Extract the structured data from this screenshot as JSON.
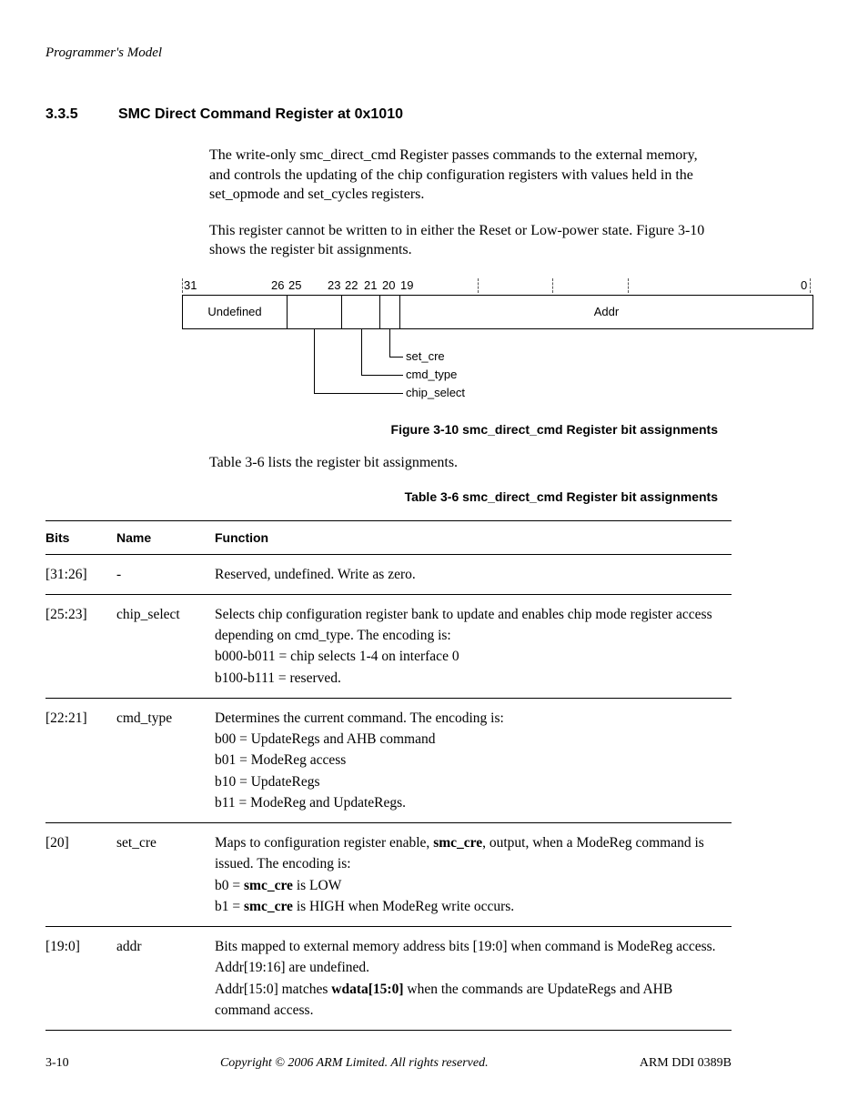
{
  "running_header": "Programmer's Model",
  "section": {
    "number": "3.3.5",
    "title": "SMC Direct Command Register at 0x1010"
  },
  "para1": "The write-only smc_direct_cmd Register passes commands to the external memory, and controls the updating of the chip configuration registers with values held in the set_opmode and set_cycles registers.",
  "para2": "This register cannot be written to in either the Reset or Low-power state. Figure 3-10 shows the register bit assignments.",
  "figure": {
    "bits": {
      "b31": "31",
      "b26": "26",
      "b25": "25",
      "b23": "23",
      "b22": "22",
      "b21": "21",
      "b20": "20",
      "b19": "19",
      "b0": "0"
    },
    "fields": {
      "undefined": "Undefined",
      "addr": "Addr"
    },
    "callouts": {
      "set_cre": "set_cre",
      "cmd_type": "cmd_type",
      "chip_select": "chip_select"
    },
    "caption": "Figure 3-10 smc_direct_cmd Register bit assignments"
  },
  "para3": "Table 3-6 lists the register bit assignments.",
  "table": {
    "caption": "Table 3-6 smc_direct_cmd Register bit assignments",
    "headers": {
      "bits": "Bits",
      "name": "Name",
      "function": "Function"
    },
    "rows": [
      {
        "bits": "[31:26]",
        "name": "-",
        "lines": [
          "Reserved, undefined. Write as zero."
        ]
      },
      {
        "bits": "[25:23]",
        "name": "chip_select",
        "lines": [
          "Selects chip configuration register bank to update and enables chip mode register access depending on cmd_type. The encoding is:",
          "b000-b011 = chip selects 1-4 on interface 0",
          "b100-b111 = reserved."
        ]
      },
      {
        "bits": "[22:21]",
        "name": "cmd_type",
        "lines": [
          "Determines the current command. The encoding is:",
          "b00 = UpdateRegs and AHB command",
          "b01 = ModeReg access",
          "b10 = UpdateRegs",
          "b11 = ModeReg and UpdateRegs."
        ]
      },
      {
        "bits": "[20]",
        "name": "set_cre",
        "html": "Maps to configuration register enable, <b>smc_cre</b>, output, when a ModeReg command is issued. The encoding is:<br>b0 = <b>smc_cre</b> is LOW<br>b1 = <b>smc_cre</b> is HIGH when ModeReg write occurs."
      },
      {
        "bits": "[19:0]",
        "name": "addr",
        "html": "Bits mapped to external memory address bits [19:0] when command is ModeReg access.<br>Addr[19:16] are undefined.<br>Addr[15:0] matches <b>wdata[15:0]</b> when the commands are UpdateRegs and AHB command access."
      }
    ]
  },
  "footer": {
    "left": "3-10",
    "mid": "Copyright © 2006 ARM Limited. All rights reserved.",
    "right": "ARM DDI 0389B"
  }
}
